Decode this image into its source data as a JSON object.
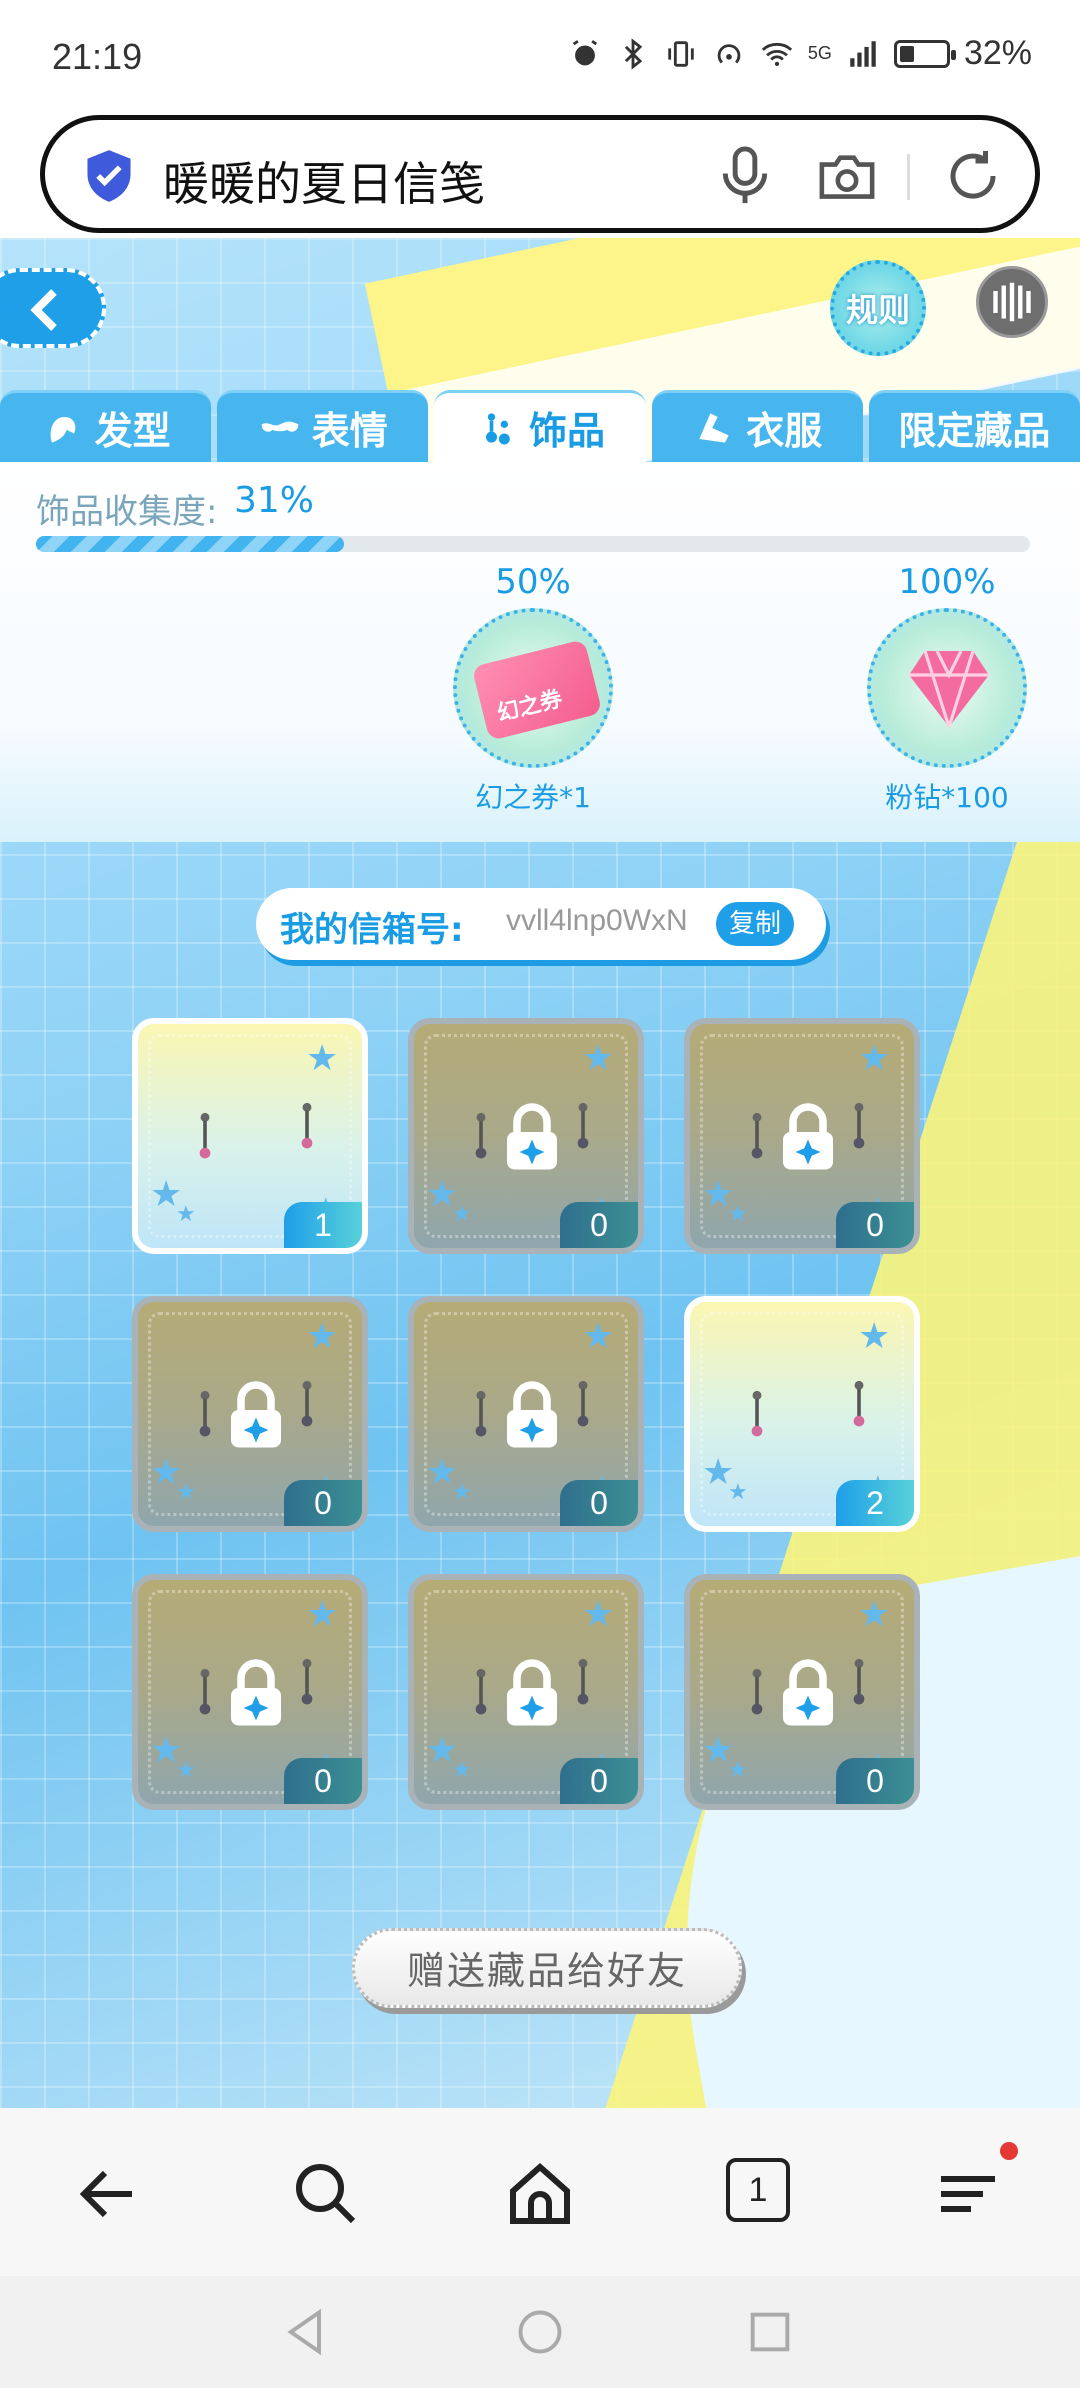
{
  "status_bar": {
    "time": "21:19",
    "battery": "32%",
    "network": "5G"
  },
  "browser": {
    "title": "暖暖的夏日信笺",
    "icons": [
      "shield-icon",
      "mic-icon",
      "camera-icon",
      "reload-icon"
    ]
  },
  "game": {
    "rules_label": "规则",
    "tabs": [
      {
        "label": "发型",
        "icon": "hair-icon",
        "active": false
      },
      {
        "label": "表情",
        "icon": "mask-icon",
        "active": false
      },
      {
        "label": "饰品",
        "icon": "earring-icon",
        "active": true
      },
      {
        "label": "衣服",
        "icon": "clothes-icon",
        "active": false
      },
      {
        "label": "限定藏品",
        "icon": "",
        "active": false
      }
    ],
    "progress": {
      "label": "饰品收集度:",
      "value": "31%",
      "fraction": 0.31
    },
    "milestones": [
      {
        "percent": "50%",
        "reward": "幻之券*1",
        "ticket_text": "幻之券"
      },
      {
        "percent": "100%",
        "reward": "粉钻*100"
      }
    ],
    "mailbox": {
      "label": "我的信箱号:",
      "value": "vvll4lnp0WxN",
      "copy_label": "复制"
    },
    "items": [
      {
        "count": "1",
        "locked": false
      },
      {
        "count": "0",
        "locked": true
      },
      {
        "count": "0",
        "locked": true
      },
      {
        "count": "0",
        "locked": true
      },
      {
        "count": "0",
        "locked": true
      },
      {
        "count": "2",
        "locked": false
      },
      {
        "count": "0",
        "locked": true
      },
      {
        "count": "0",
        "locked": true
      },
      {
        "count": "0",
        "locked": true
      }
    ],
    "gift_button": "赠送藏品给好友"
  },
  "toolbar": {
    "tab_count": "1"
  },
  "colors": {
    "accent": "#1e9fe8",
    "yellow": "#fbf47b",
    "badge_red": "#e53935"
  }
}
